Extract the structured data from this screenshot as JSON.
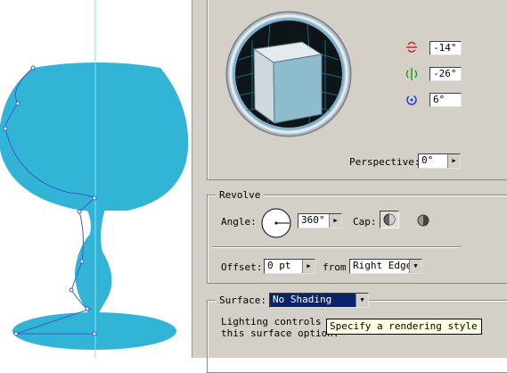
{
  "rotation": {
    "x_angle": "-14°",
    "y_angle": "-26°",
    "z_angle": "6°",
    "perspective_label": "Perspective:",
    "perspective_value": "0°"
  },
  "revolve": {
    "title": "Revolve",
    "angle_label": "Angle:",
    "angle_value": "360°",
    "cap_label": "Cap:",
    "offset_label": "Offset:",
    "offset_value": "0 pt",
    "from_label": "from",
    "from_value": "Right Edge"
  },
  "surface": {
    "label": "Surface:",
    "value": "No Shading",
    "note_line1": "Lighting controls are",
    "note_line2": "this surface option.",
    "tooltip": "Specify a rendering style"
  },
  "colors": {
    "glass_fill": "#31b4d6",
    "guide": "#7ee4f0",
    "path_stroke": "#3a5ccc",
    "selection": "#0a246a",
    "panel_bg": "#d4d0c8"
  },
  "icons": {
    "x_axis": "rotate-x-icon",
    "y_axis": "rotate-y-icon",
    "z_axis": "rotate-z-icon",
    "cap_on": "cap-on-icon",
    "cap_off": "cap-off-icon",
    "angle_dial": "angle-dial-icon"
  }
}
